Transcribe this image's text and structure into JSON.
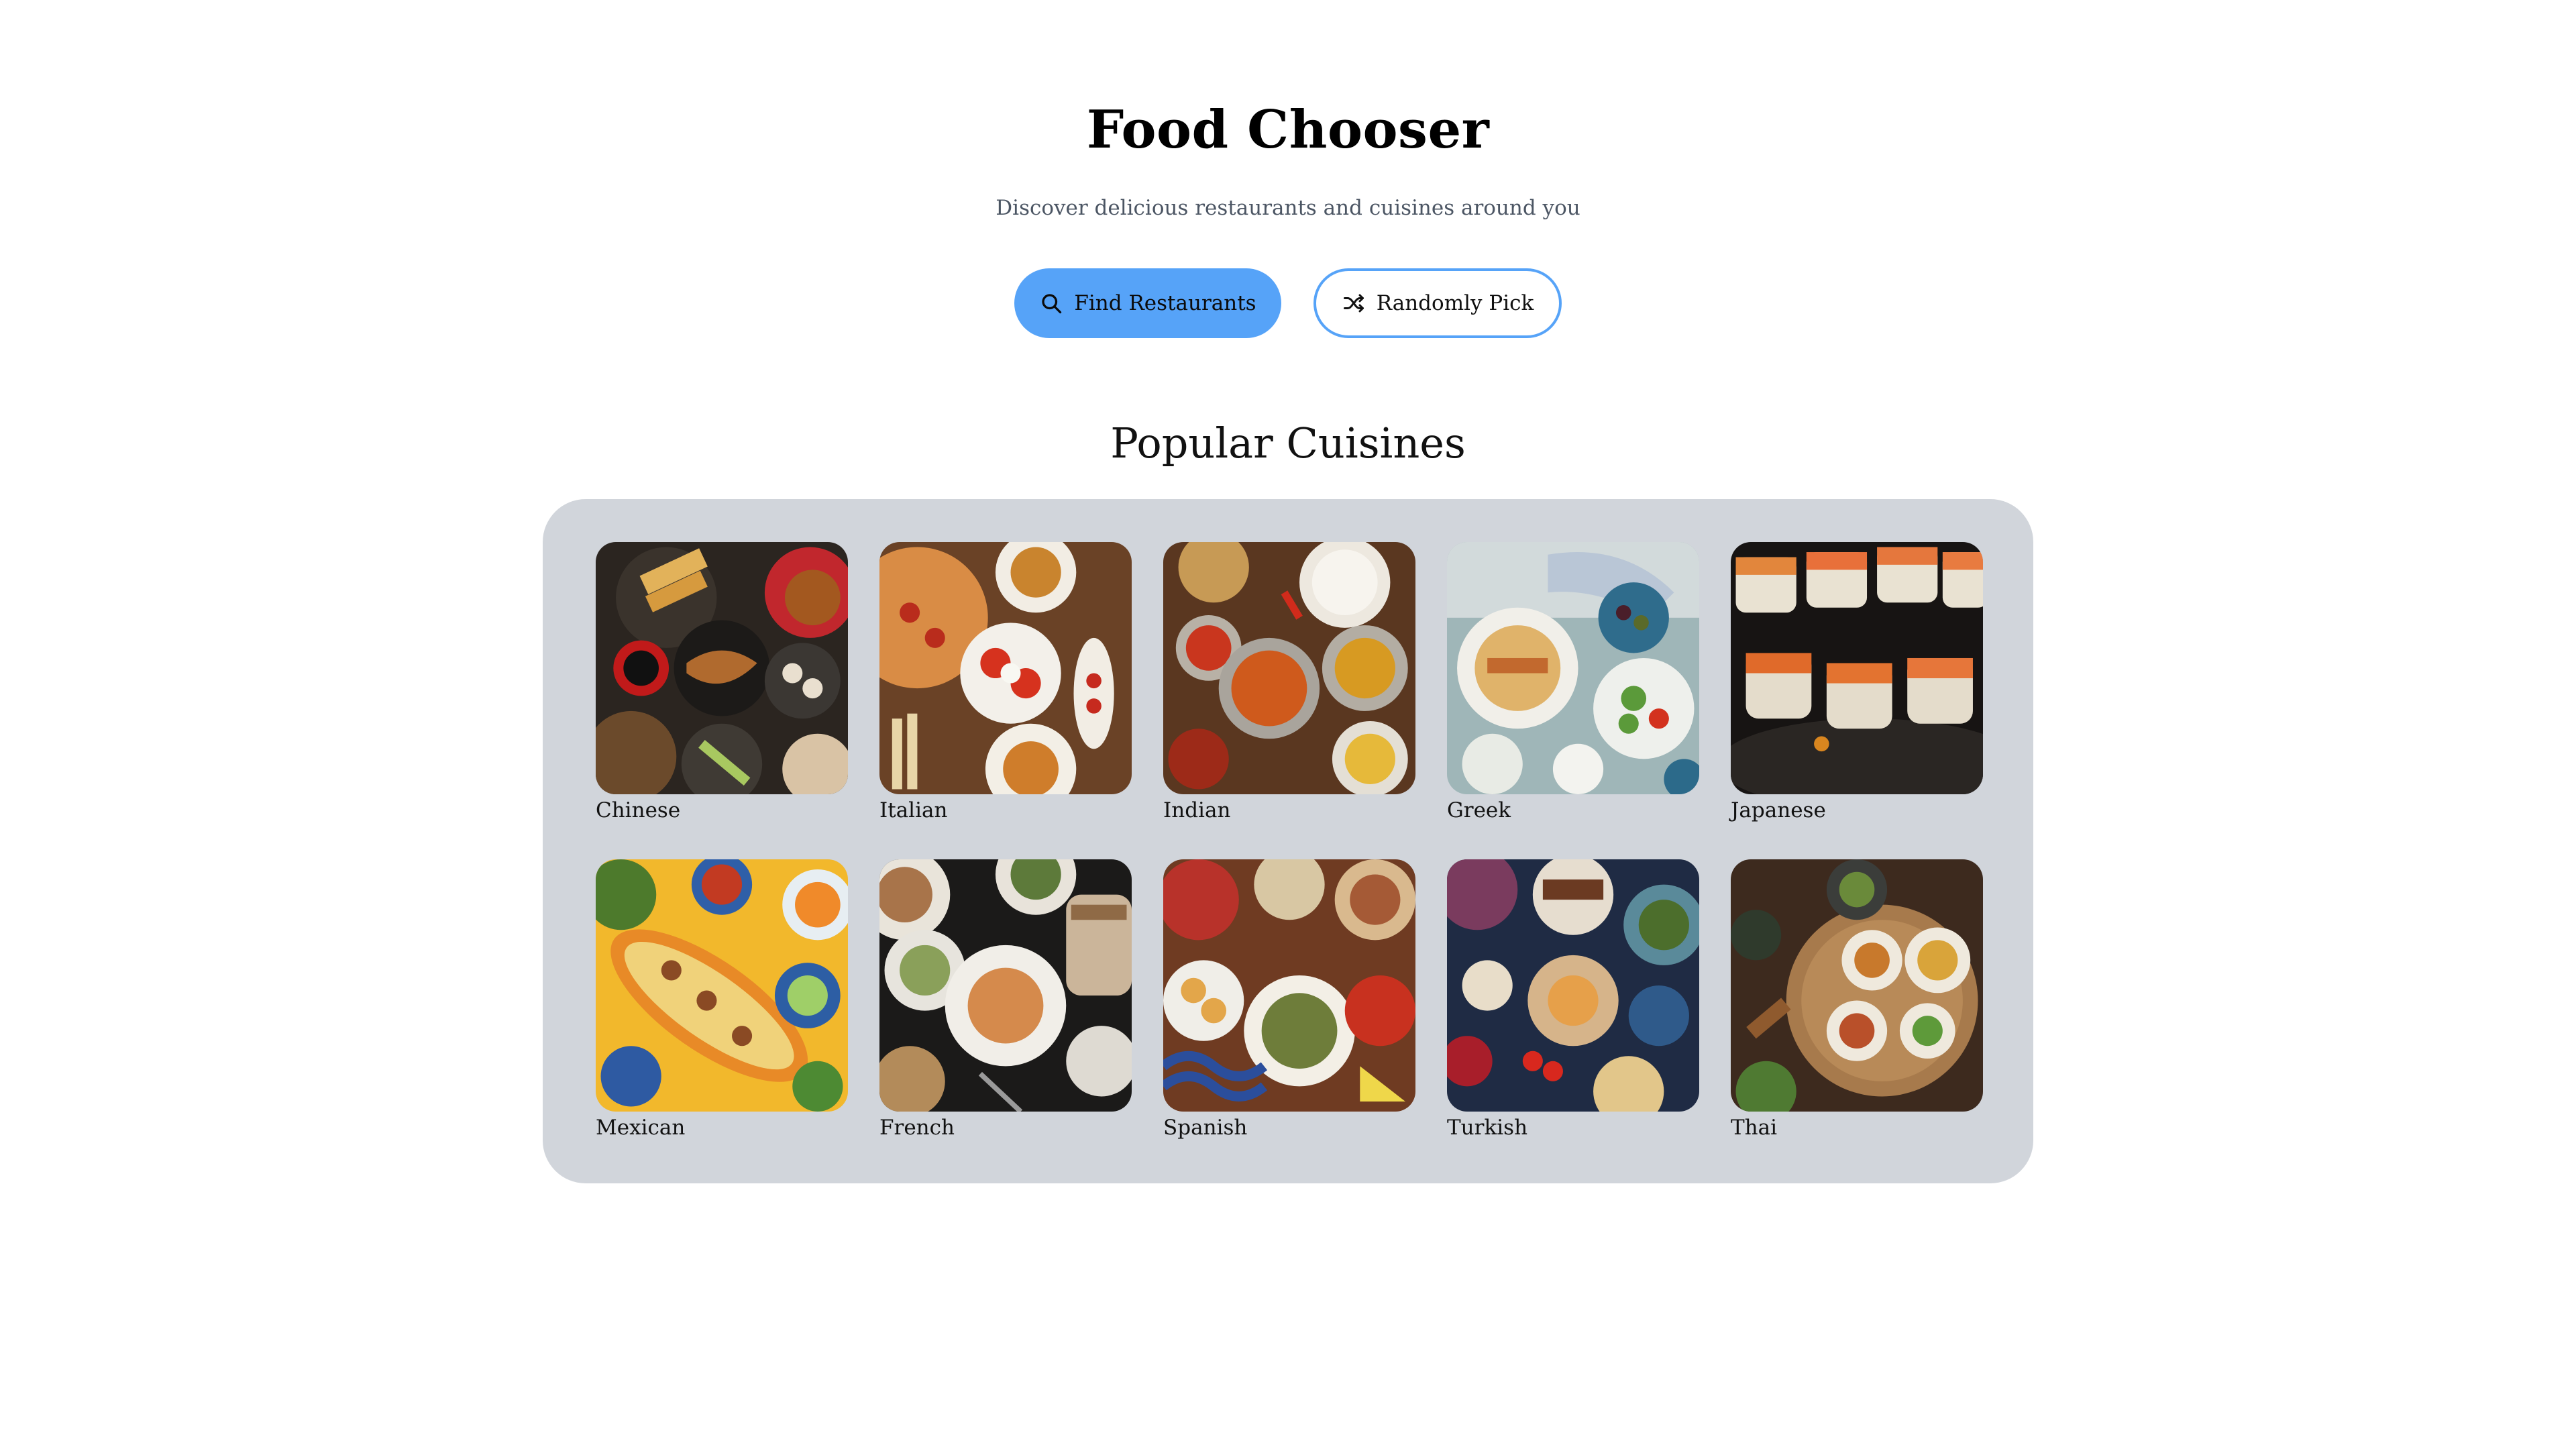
{
  "header": {
    "title": "Food Chooser",
    "subtitle": "Discover delicious restaurants and cuisines around you"
  },
  "actions": {
    "find": {
      "label": "Find Restaurants",
      "icon": "search-icon"
    },
    "random": {
      "label": "Randomly Pick",
      "icon": "shuffle-icon"
    }
  },
  "section": {
    "title": "Popular Cuisines"
  },
  "cuisines": [
    {
      "label": "Chinese"
    },
    {
      "label": "Italian"
    },
    {
      "label": "Indian"
    },
    {
      "label": "Greek"
    },
    {
      "label": "Japanese"
    },
    {
      "label": "Mexican"
    },
    {
      "label": "French"
    },
    {
      "label": "Spanish"
    },
    {
      "label": "Turkish"
    },
    {
      "label": "Thai"
    }
  ],
  "colors": {
    "accent": "#56a3f8",
    "panel": "#d1d5db",
    "subtitle": "#4b5563"
  }
}
